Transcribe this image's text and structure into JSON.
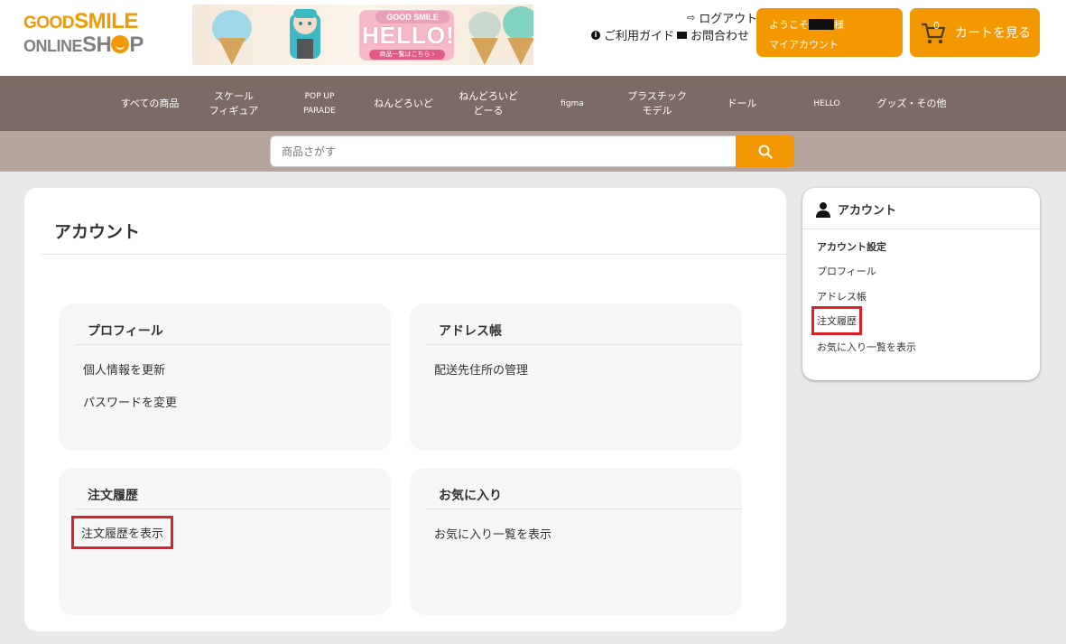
{
  "logo": {
    "line1_a": "GOOD",
    "line1_b": "SMILE",
    "line2_a": "ONLINE",
    "line2_b": "SH",
    "line2_c": "P"
  },
  "banner": {
    "top_label": "GOOD SMILE",
    "title": "HELLO!",
    "sub_label": "商品一覧はこちら ›"
  },
  "utility": {
    "guide": "ご利用ガイド",
    "logout": "ログアウト",
    "contact": "お問合わせ"
  },
  "welcome": {
    "greeting_prefix": "ようこそ",
    "greeting_suffix": "様",
    "my_account": "マイアカウント"
  },
  "cart": {
    "count": "0",
    "label": "カートを見る"
  },
  "nav": [
    {
      "label": "すべての商品"
    },
    {
      "label": "スケール\nフィギュア"
    },
    {
      "label": "POP UP\nPARADE"
    },
    {
      "label": "ねんどろいど"
    },
    {
      "label": "ねんどろいど\nどーる"
    },
    {
      "label": "figma"
    },
    {
      "label": "プラスチック\nモデル"
    },
    {
      "label": "ドール"
    },
    {
      "label": "HELLO"
    },
    {
      "label": "グッズ・その他"
    }
  ],
  "search": {
    "placeholder": "商品さがす"
  },
  "main": {
    "title": "アカウント",
    "boxes": [
      {
        "title": "プロフィール",
        "links": [
          "個人情報を更新",
          "パスワードを変更"
        ]
      },
      {
        "title": "アドレス帳",
        "links": [
          "配送先住所の管理"
        ]
      },
      {
        "title": "注文履歴",
        "links": [
          "注文履歴を表示"
        ]
      },
      {
        "title": "お気に入り",
        "links": [
          "お気に入り一覧を表示"
        ]
      }
    ]
  },
  "sidebar": {
    "title": "アカウント",
    "section": "アカウント設定",
    "links": [
      "プロフィール",
      "アドレス帳",
      "注文履歴",
      "お気に入り一覧を表示"
    ]
  },
  "colors": {
    "accent": "#f39800",
    "nav": "#7b6b64",
    "search_bar": "#b5a49b",
    "highlight": "#d9222a"
  }
}
